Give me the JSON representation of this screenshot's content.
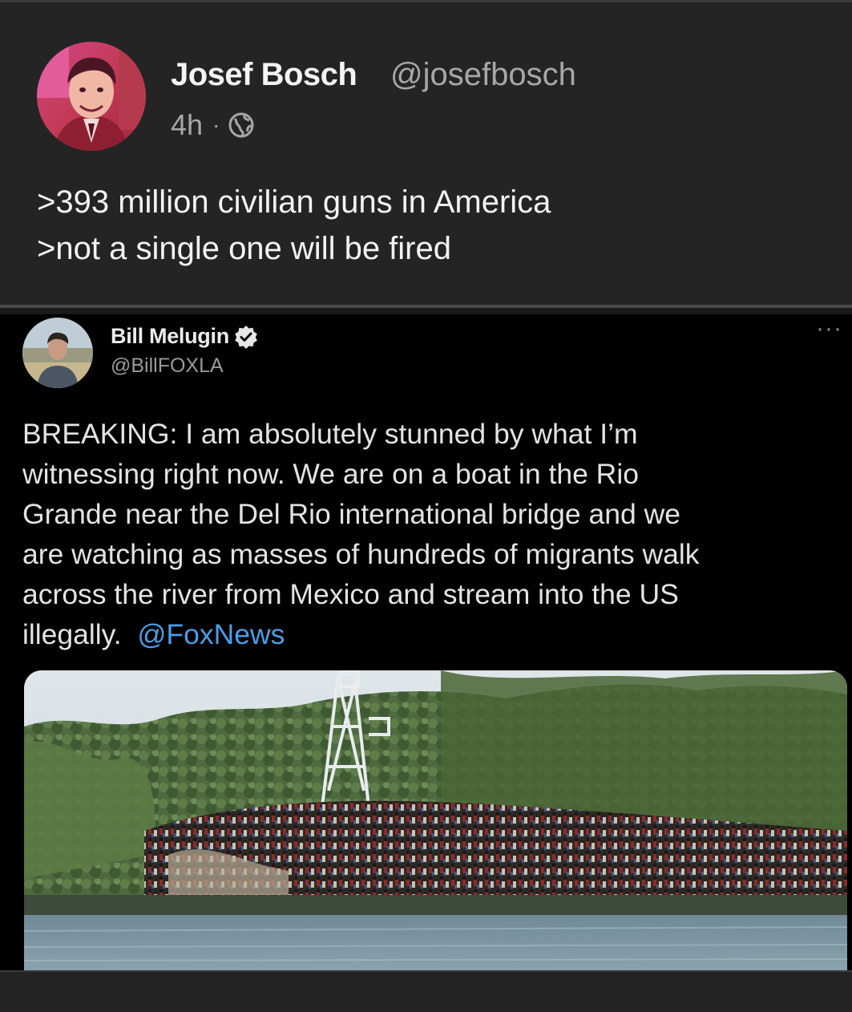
{
  "post": {
    "author_name": "Josef Bosch",
    "author_handle": "@josefbosch",
    "time": "4h",
    "separator": "·",
    "visibility_icon": "globe-icon",
    "lines": [
      ">393 million civilian guns in America",
      ">not a single one will be fired"
    ]
  },
  "quoted_tweet": {
    "author_name": "Bill Melugin",
    "author_handle": "@BillFOXLA",
    "verified_icon": "verified-badge-icon",
    "more_icon": "···",
    "text_lines": [
      "BREAKING: I am absolutely stunned by what I’m",
      "witnessing right now. We are on a boat in the Rio",
      "Grande near the Del Rio international bridge and we",
      "are watching as masses of hundreds of migrants walk",
      "across the river from Mexico and stream into the US"
    ],
    "last_line_text": "illegally.",
    "mention": "@FoxNews",
    "mention_color": "#4a9ee8"
  },
  "colors": {
    "background": "#222222",
    "embed_background": "#000000",
    "handle_gray": "#a7a7a7"
  }
}
